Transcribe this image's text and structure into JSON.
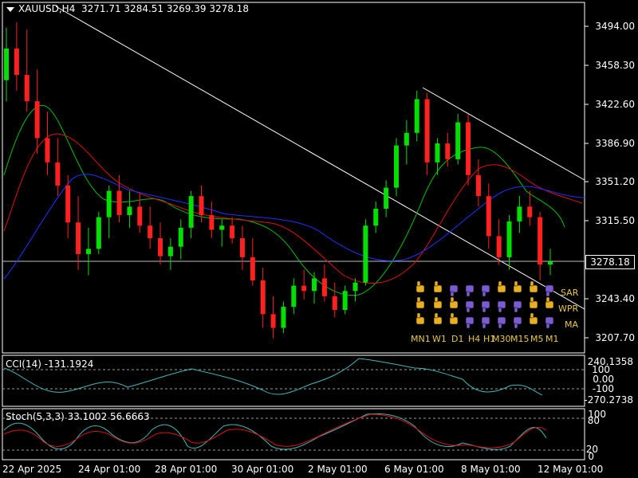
{
  "header": {
    "symbol": "XAUUSD,H4",
    "open": "3271.71",
    "high": "3284.51",
    "low": "3269.39",
    "close": "3278.18"
  },
  "price_axis": {
    "labels": [
      "3494.00",
      "3458.30",
      "3422.60",
      "3386.90",
      "3351.20",
      "3315.50",
      "3243.40",
      "3207.70"
    ],
    "current_price": "3278.18"
  },
  "cci": {
    "title": "CCI(14) -131.1924",
    "levels": [
      "240.1358",
      "100",
      "0.00",
      "-100",
      "-270.2738"
    ]
  },
  "stoch": {
    "title": "Stoch(5,3,3) 33.1002 56.6663",
    "levels": [
      "100",
      "80",
      "20",
      "0"
    ]
  },
  "time_axis": {
    "labels": [
      "22 Apr 2025",
      "24 Apr 01:00",
      "28 Apr 01:00",
      "30 Apr 01:00",
      "2 May 01:00",
      "6 May 01:00",
      "8 May 01:00",
      "12 May 01:00"
    ]
  },
  "signal_panel": {
    "timeframes": [
      "MN1",
      "W1",
      "D1",
      "H4",
      "H1",
      "M30",
      "M15",
      "M5",
      "M1"
    ],
    "indicators": [
      "SAR",
      "WPR",
      "MA"
    ]
  },
  "colors": {
    "bull": "#00e000",
    "bear": "#ff2020",
    "ma_fast": "#00c000",
    "ma_mid": "#e01010",
    "ma_slow": "#2030ff",
    "cci_line": "#3fb8b8",
    "stoch_main": "#3fb8b8",
    "stoch_signal": "#e01010",
    "thumb_up": "#e7b020",
    "thumb_down": "#7a5bd0"
  },
  "chart_data": {
    "type": "candlestick",
    "title": "XAUUSD,H4",
    "ylim": [
      3195,
      3520
    ],
    "x_labels": [
      "22 Apr 2025",
      "24 Apr 01:00",
      "28 Apr 01:00",
      "30 Apr 01:00",
      "2 May 01:00",
      "6 May 01:00",
      "8 May 01:00",
      "12 May 01:00"
    ],
    "candles": [
      [
        3450,
        3500,
        3430,
        3480
      ],
      [
        3480,
        3505,
        3440,
        3455
      ],
      [
        3455,
        3498,
        3420,
        3430
      ],
      [
        3430,
        3460,
        3380,
        3395
      ],
      [
        3395,
        3420,
        3360,
        3372
      ],
      [
        3372,
        3395,
        3340,
        3350
      ],
      [
        3350,
        3360,
        3300,
        3315
      ],
      [
        3315,
        3340,
        3270,
        3285
      ],
      [
        3285,
        3310,
        3265,
        3290
      ],
      [
        3290,
        3325,
        3285,
        3320
      ],
      [
        3320,
        3350,
        3300,
        3345
      ],
      [
        3345,
        3360,
        3315,
        3322
      ],
      [
        3322,
        3345,
        3310,
        3330
      ],
      [
        3330,
        3342,
        3305,
        3312
      ],
      [
        3312,
        3330,
        3290,
        3300
      ],
      [
        3300,
        3315,
        3275,
        3283
      ],
      [
        3283,
        3300,
        3270,
        3292
      ],
      [
        3292,
        3318,
        3280,
        3310
      ],
      [
        3310,
        3345,
        3300,
        3340
      ],
      [
        3340,
        3350,
        3315,
        3322
      ],
      [
        3322,
        3335,
        3300,
        3308
      ],
      [
        3308,
        3318,
        3292,
        3312
      ],
      [
        3312,
        3320,
        3295,
        3300
      ],
      [
        3300,
        3312,
        3270,
        3282
      ],
      [
        3282,
        3300,
        3255,
        3260
      ],
      [
        3260,
        3272,
        3215,
        3228
      ],
      [
        3228,
        3245,
        3205,
        3215
      ],
      [
        3215,
        3240,
        3210,
        3235
      ],
      [
        3235,
        3262,
        3228,
        3255
      ],
      [
        3255,
        3270,
        3242,
        3250
      ],
      [
        3250,
        3268,
        3238,
        3262
      ],
      [
        3262,
        3275,
        3240,
        3245
      ],
      [
        3245,
        3258,
        3225,
        3232
      ],
      [
        3232,
        3255,
        3228,
        3250
      ],
      [
        3250,
        3262,
        3240,
        3258
      ],
      [
        3258,
        3318,
        3255,
        3312
      ],
      [
        3312,
        3335,
        3305,
        3328
      ],
      [
        3328,
        3355,
        3320,
        3348
      ],
      [
        3348,
        3395,
        3340,
        3388
      ],
      [
        3388,
        3412,
        3370,
        3400
      ],
      [
        3400,
        3440,
        3392,
        3432
      ],
      [
        3432,
        3438,
        3360,
        3372
      ],
      [
        3372,
        3395,
        3360,
        3390
      ],
      [
        3390,
        3400,
        3368,
        3375
      ],
      [
        3375,
        3418,
        3370,
        3410
      ],
      [
        3410,
        3418,
        3350,
        3360
      ],
      [
        3360,
        3375,
        3330,
        3340
      ],
      [
        3340,
        3352,
        3290,
        3302
      ],
      [
        3302,
        3318,
        3275,
        3282
      ],
      [
        3282,
        3322,
        3270,
        3316
      ],
      [
        3316,
        3340,
        3305,
        3330
      ],
      [
        3330,
        3345,
        3312,
        3320
      ],
      [
        3320,
        3325,
        3260,
        3275
      ],
      [
        3275,
        3290,
        3265,
        3278
      ]
    ]
  }
}
